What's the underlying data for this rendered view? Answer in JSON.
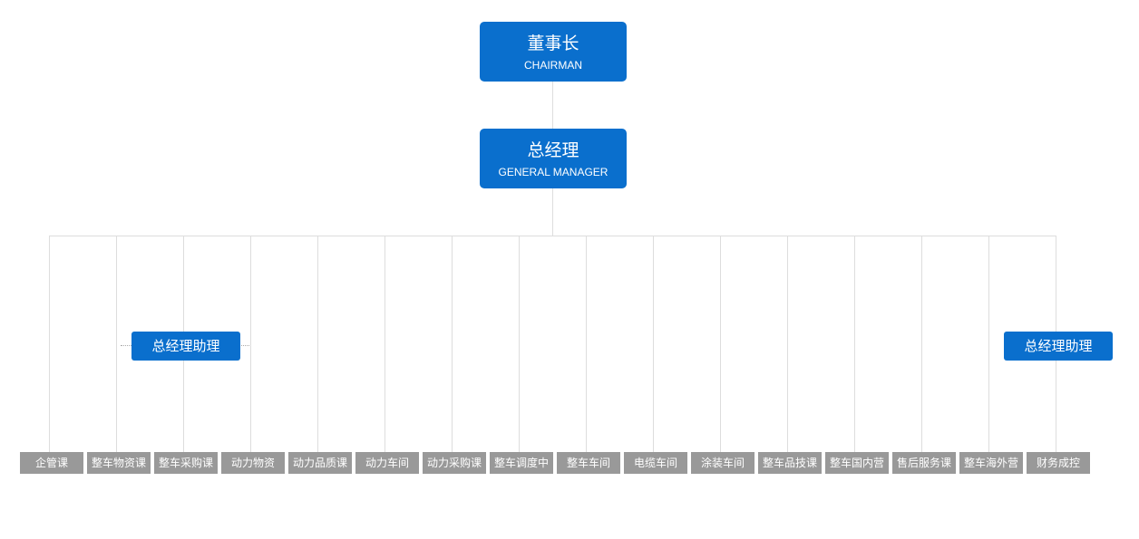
{
  "chairman": {
    "zh": "董事长",
    "en": "CHAIRMAN"
  },
  "general_manager": {
    "zh": "总经理",
    "en": "GENERAL MANAGER"
  },
  "assistants": [
    {
      "label": "总经理助理"
    },
    {
      "label": "总经理助理"
    }
  ],
  "departments": [
    "企管课",
    "整车物资课",
    "整车采购课",
    "动力物资",
    "动力品质课",
    "动力车间",
    "动力采购课",
    "整车调度中",
    "整车车间",
    "电缆车间",
    "涂装车间",
    "整车品技课",
    "整车国内营",
    "售后服务课",
    "整车海外营",
    "财务成控"
  ],
  "colors": {
    "exec_box": "#0a6fcd",
    "dept_box": "#999999",
    "connector": "#dddddd"
  }
}
